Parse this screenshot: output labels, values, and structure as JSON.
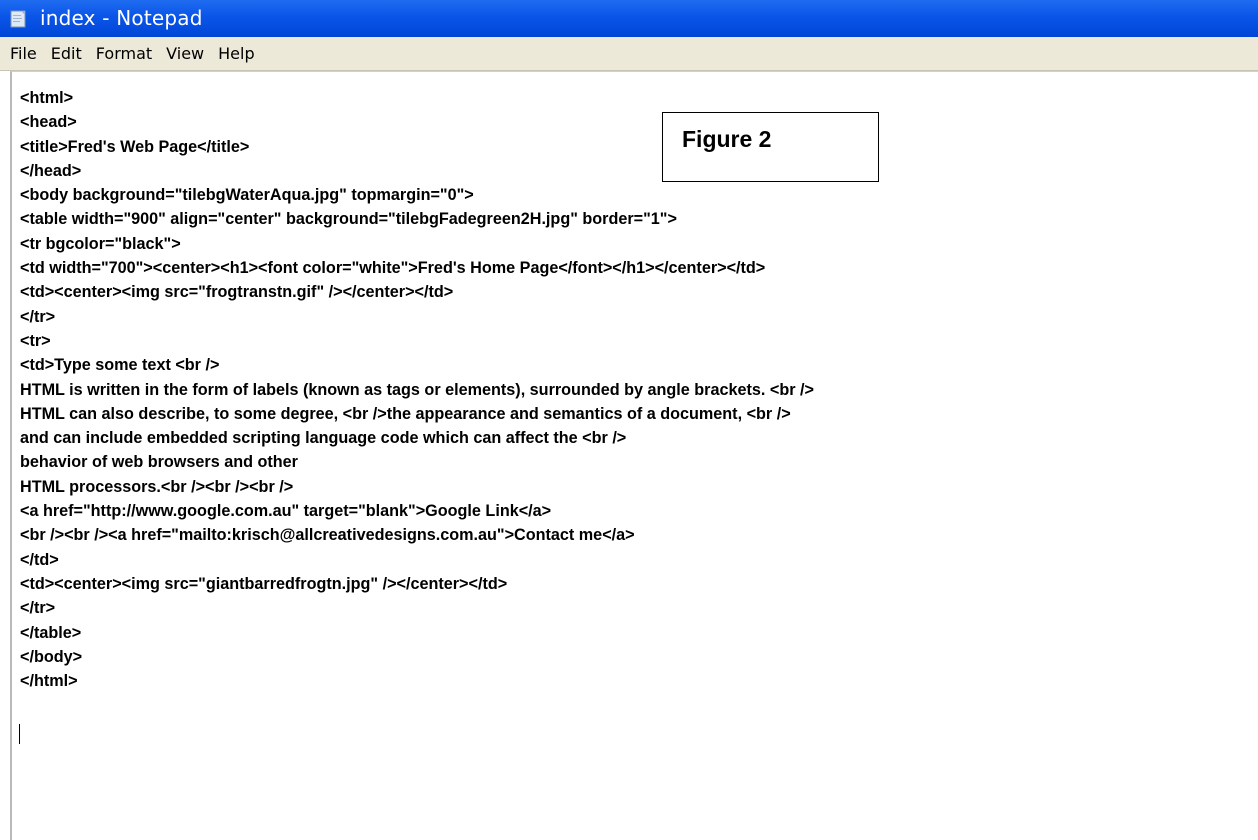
{
  "window": {
    "title": "index - Notepad",
    "icon": "notepad-icon"
  },
  "menu": {
    "items": [
      {
        "label": "File"
      },
      {
        "label": "Edit"
      },
      {
        "label": "Format"
      },
      {
        "label": "View"
      },
      {
        "label": "Help"
      }
    ]
  },
  "editor": {
    "lines": [
      "<html>",
      "<head>",
      "<title>Fred's Web Page</title>",
      "</head>",
      "<body background=\"tilebgWaterAqua.jpg\" topmargin=\"0\">",
      "<table width=\"900\" align=\"center\" background=\"tilebgFadegreen2H.jpg\" border=\"1\">",
      "<tr bgcolor=\"black\">",
      "<td width=\"700\"><center><h1><font color=\"white\">Fred's Home Page</font></h1></center></td>",
      "<td><center><img src=\"frogtranstn.gif\" /></center></td>",
      "</tr>",
      "<tr>",
      "<td>Type some text <br />",
      "HTML is written in the form of labels (known as tags or elements), surrounded by angle brackets. <br />",
      "HTML can also describe, to some degree, <br />the appearance and semantics of a document, <br />",
      "and can include embedded scripting language code which can affect the <br />",
      "behavior of web browsers and other",
      "HTML processors.<br /><br /><br />",
      "<a href=\"http://www.google.com.au\" target=\"blank\">Google Link</a>",
      "<br /><br /><a href=\"mailto:krisch@allcreativedesigns.com.au\">Contact me</a>",
      "</td>",
      "<td><center><img src=\"giantbarredfrogtn.jpg\" /></center></td>",
      "</tr>",
      "</table>",
      "</body>",
      "</html>"
    ]
  },
  "annotation": {
    "label": "Figure 2"
  },
  "colors": {
    "titlebar": "#0a55e8",
    "menubar": "#ece9d8",
    "editor_bg": "#ffffff",
    "text": "#000000"
  }
}
